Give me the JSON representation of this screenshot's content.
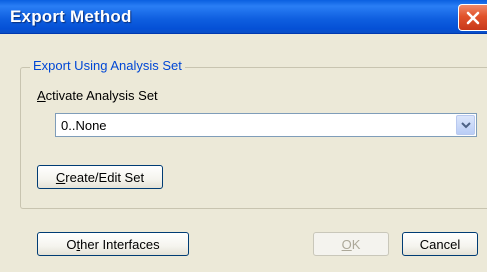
{
  "window": {
    "title": "Export Method",
    "close_label": "Close"
  },
  "group": {
    "label": "Export Using Analysis Set"
  },
  "activate": {
    "label_mnemonic": "A",
    "label_rest": "ctivate Analysis Set",
    "selected_value": "0..None"
  },
  "buttons": {
    "create_mnemonic": "C",
    "create_rest": "reate/Edit Set",
    "other_first": "O",
    "other_mnemonic": "t",
    "other_rest": "her Interfaces",
    "ok_mnemonic": "O",
    "ok_rest": "K",
    "ok_enabled": false,
    "cancel_label": "Cancel"
  },
  "colors": {
    "titlebar": "#0550d6",
    "group_label": "#0047d5",
    "window_bg": "#ece9d8",
    "close_red": "#e1532b"
  },
  "icons": {
    "close": "close-x-icon",
    "dropdown": "chevron-down-icon"
  }
}
